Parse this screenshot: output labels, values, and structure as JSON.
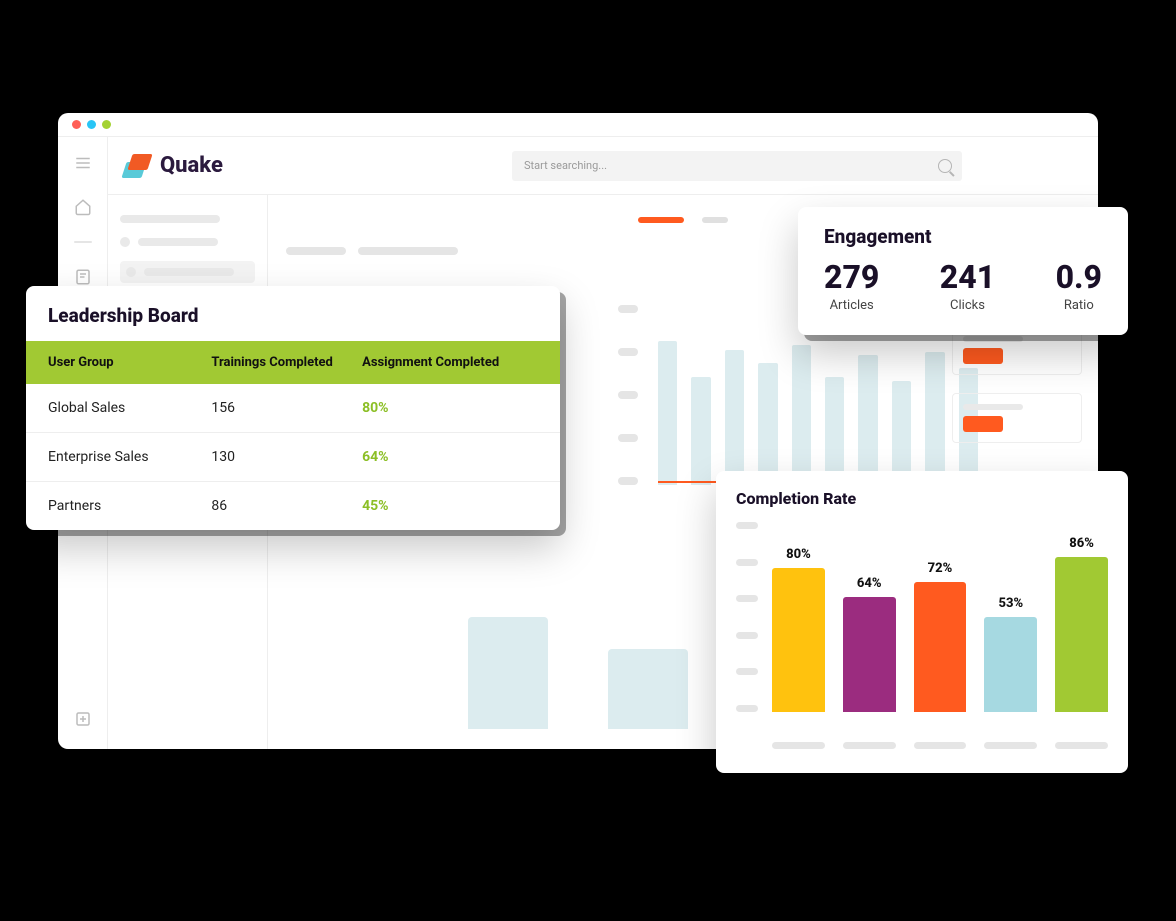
{
  "app": {
    "name": "Quake",
    "search_placeholder": "Start searching..."
  },
  "engagement": {
    "title": "Engagement",
    "metrics": [
      {
        "value": "279",
        "label": "Articles"
      },
      {
        "value": "241",
        "label": "Clicks"
      },
      {
        "value": "0.9",
        "label": "Ratio"
      }
    ]
  },
  "leadership": {
    "title": "Leadership Board",
    "columns": [
      "User Group",
      "Trainings Completed",
      "Assignment Completed"
    ],
    "rows": [
      {
        "group": "Global Sales",
        "trainings": "156",
        "assignment": "80%"
      },
      {
        "group": "Enterprise Sales",
        "trainings": "130",
        "assignment": "64%"
      },
      {
        "group": "Partners",
        "trainings": "86",
        "assignment": "45%"
      }
    ]
  },
  "completion": {
    "title": "Completion Rate",
    "bars": [
      {
        "label": "80%",
        "value": 80,
        "color": "#ffc20e"
      },
      {
        "label": "64%",
        "value": 64,
        "color": "#9b2c7f"
      },
      {
        "label": "72%",
        "value": 72,
        "color": "#ff5a1f"
      },
      {
        "label": "53%",
        "value": 53,
        "color": "#a6d9e1"
      },
      {
        "label": "86%",
        "value": 86,
        "color": "#a1c933"
      }
    ]
  },
  "colors": {
    "accent_orange": "#ff5a1f",
    "accent_green": "#a1c933"
  },
  "chart_data": {
    "type": "bar",
    "title": "Completion Rate",
    "categories": [
      "",
      "",
      "",
      "",
      ""
    ],
    "values": [
      80,
      64,
      72,
      53,
      86
    ],
    "ylim": [
      0,
      100
    ],
    "xlabel": "",
    "ylabel": ""
  }
}
